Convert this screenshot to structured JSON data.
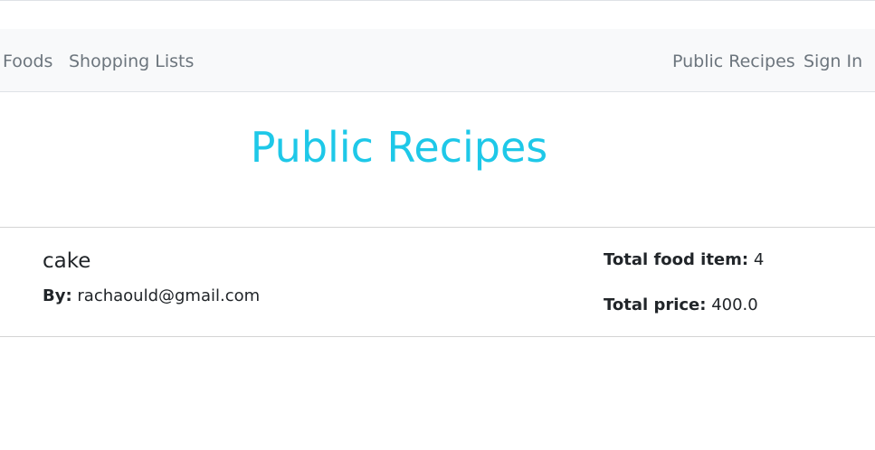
{
  "nav": {
    "left": [
      "Foods",
      "Shopping Lists"
    ],
    "right": [
      "Public Recipes",
      "Sign In"
    ]
  },
  "page": {
    "title": "Public Recipes"
  },
  "recipes": [
    {
      "name": "cake",
      "by_label": "By:",
      "author": "rachaould@gmail.com",
      "total_items_label": "Total food item:",
      "total_items": "4",
      "total_price_label": "Total price:",
      "total_price": "400.0"
    }
  ],
  "colors": {
    "title": "#1ec8e8",
    "navbar_bg": "#f8f9fa",
    "nav_link": "#6c757d"
  }
}
